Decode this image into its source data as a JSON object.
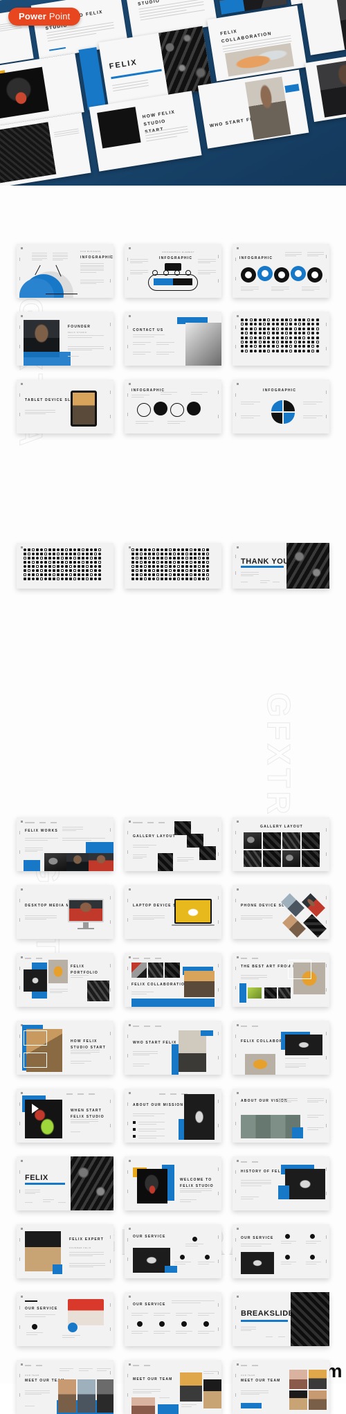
{
  "badge": {
    "bold": "Power",
    "light": " Point",
    "color": "#e8461e"
  },
  "theme": {
    "accent_blue": "#1878c8",
    "light_blue": "#3d9ae0",
    "hero_blue": "#1d4f7c",
    "dark": "#111111",
    "slide_bg": "#f2f2f2",
    "page_bg": "#ffffff"
  },
  "watermarks": {
    "center": "GFXTRA",
    "vertical_top": "GFXTRA",
    "vertical_bottom": "GFXTRA",
    "footer": "gfxtra.com"
  },
  "hero": {
    "slides": [
      {
        "title": "WELCOME TO FELIX STUDIO",
        "kicker": "FELIX STUDIO"
      },
      {
        "title": "HISTORY OF FELIX STUDIO",
        "kicker": ""
      },
      {
        "title": "FELIX COLLABORATION",
        "kicker": ""
      },
      {
        "title": "FELIX",
        "kicker": "Business Presentation Template"
      },
      {
        "title": "HOW FELIX STUDIO START",
        "kicker": ""
      },
      {
        "title": "WHO START FELIX STUDIO",
        "kicker": ""
      }
    ]
  },
  "section_infographic": {
    "rows": [
      {
        "slides": [
          {
            "title": "INFOGRAPHIC",
            "kicker": "OUR BUSINESS",
            "kind": "donut-chart"
          },
          {
            "title": "INFOGRAPHIC",
            "kicker": "INFOGRAPHIC ELEMENT",
            "kind": "timeline-arrow"
          },
          {
            "title": "INFOGRAPHIC",
            "kicker": "",
            "kind": "wave-circles"
          }
        ]
      },
      {
        "slides": [
          {
            "title": "FOUNDER",
            "kicker": "FELIX STUDIO",
            "kind": "founder-photo"
          },
          {
            "title": "CONTACT US",
            "kicker": "",
            "kind": "contact"
          },
          {
            "title": "",
            "kicker": "",
            "kind": "icon-sheet"
          }
        ]
      },
      {
        "slides": [
          {
            "title": "TABLET DEVICE SLIDE",
            "kicker": "",
            "kind": "tablet"
          },
          {
            "title": "INFOGRAPHIC",
            "kicker": "",
            "kind": "wave-4"
          },
          {
            "title": "INFOGRAPHIC",
            "kicker": "",
            "kind": "quad-circle"
          }
        ]
      }
    ]
  },
  "section_icons": {
    "slides": [
      {
        "title": "",
        "kind": "icon-sheet-a"
      },
      {
        "title": "",
        "kind": "icon-sheet-b"
      },
      {
        "title": "THANK YOU",
        "kicker": "FELIX STUDIO",
        "kind": "thankyou"
      }
    ]
  },
  "section_layouts": {
    "rows": [
      [
        {
          "title": "FELIX WORKS",
          "kicker": "OUR WORKS"
        },
        {
          "title": "GALLERY LAYOUT",
          "kicker": ""
        },
        {
          "title": "GALLERY LAYOUT",
          "kicker": ""
        }
      ],
      [
        {
          "title": "DESKTOP MEDIA MOCKUP",
          "kicker": ""
        },
        {
          "title": "LAPTOP DEVICE SLIDE",
          "kicker": ""
        },
        {
          "title": "PHONE DEVICE SLIDE",
          "kicker": ""
        }
      ],
      [
        {
          "title": "FELIX PORTFOLIO",
          "kicker": ""
        },
        {
          "title": "FELIX COLLABORATION",
          "kicker": ""
        },
        {
          "title": "THE BEST ART FROM MAKER",
          "kicker": ""
        }
      ],
      [
        {
          "title": "HOW FELIX STUDIO START",
          "kicker": ""
        },
        {
          "title": "WHO START FELIX STUDIO",
          "kicker": ""
        },
        {
          "title": "FELIX COLLABORATION",
          "kicker": ""
        }
      ],
      [
        {
          "title": "WHEN START FELIX STUDIO",
          "kicker": ""
        },
        {
          "title": "ABOUT OUR MISSION",
          "kicker": ""
        },
        {
          "title": "ABOUT OUR VISION",
          "kicker": ""
        }
      ],
      [
        {
          "title": "FELIX",
          "kicker": "Business Presentation Template"
        },
        {
          "title": "WELCOME TO FELIX STUDIO",
          "kicker": ""
        },
        {
          "title": "HISTORY OF FELIX STUDIO",
          "kicker": ""
        }
      ],
      [
        {
          "title": "FELIX EXPERT",
          "kicker": ""
        },
        {
          "title": "OUR SERVICE",
          "kicker": ""
        },
        {
          "title": "OUR SERVICE",
          "kicker": ""
        }
      ],
      [
        {
          "title": "OUR SERVICE",
          "kicker": ""
        },
        {
          "title": "OUR SERVICE",
          "kicker": ""
        },
        {
          "title": "BREAKSLIDE",
          "kicker": "FELIX STUDIO"
        }
      ],
      [
        {
          "title": "MEET OUR TEAM",
          "kicker": "OUR TEAM"
        },
        {
          "title": "MEET OUR TEAM",
          "kicker": ""
        },
        {
          "title": "MEET OUR TEAM",
          "kicker": "OUR TEAM"
        }
      ]
    ]
  }
}
